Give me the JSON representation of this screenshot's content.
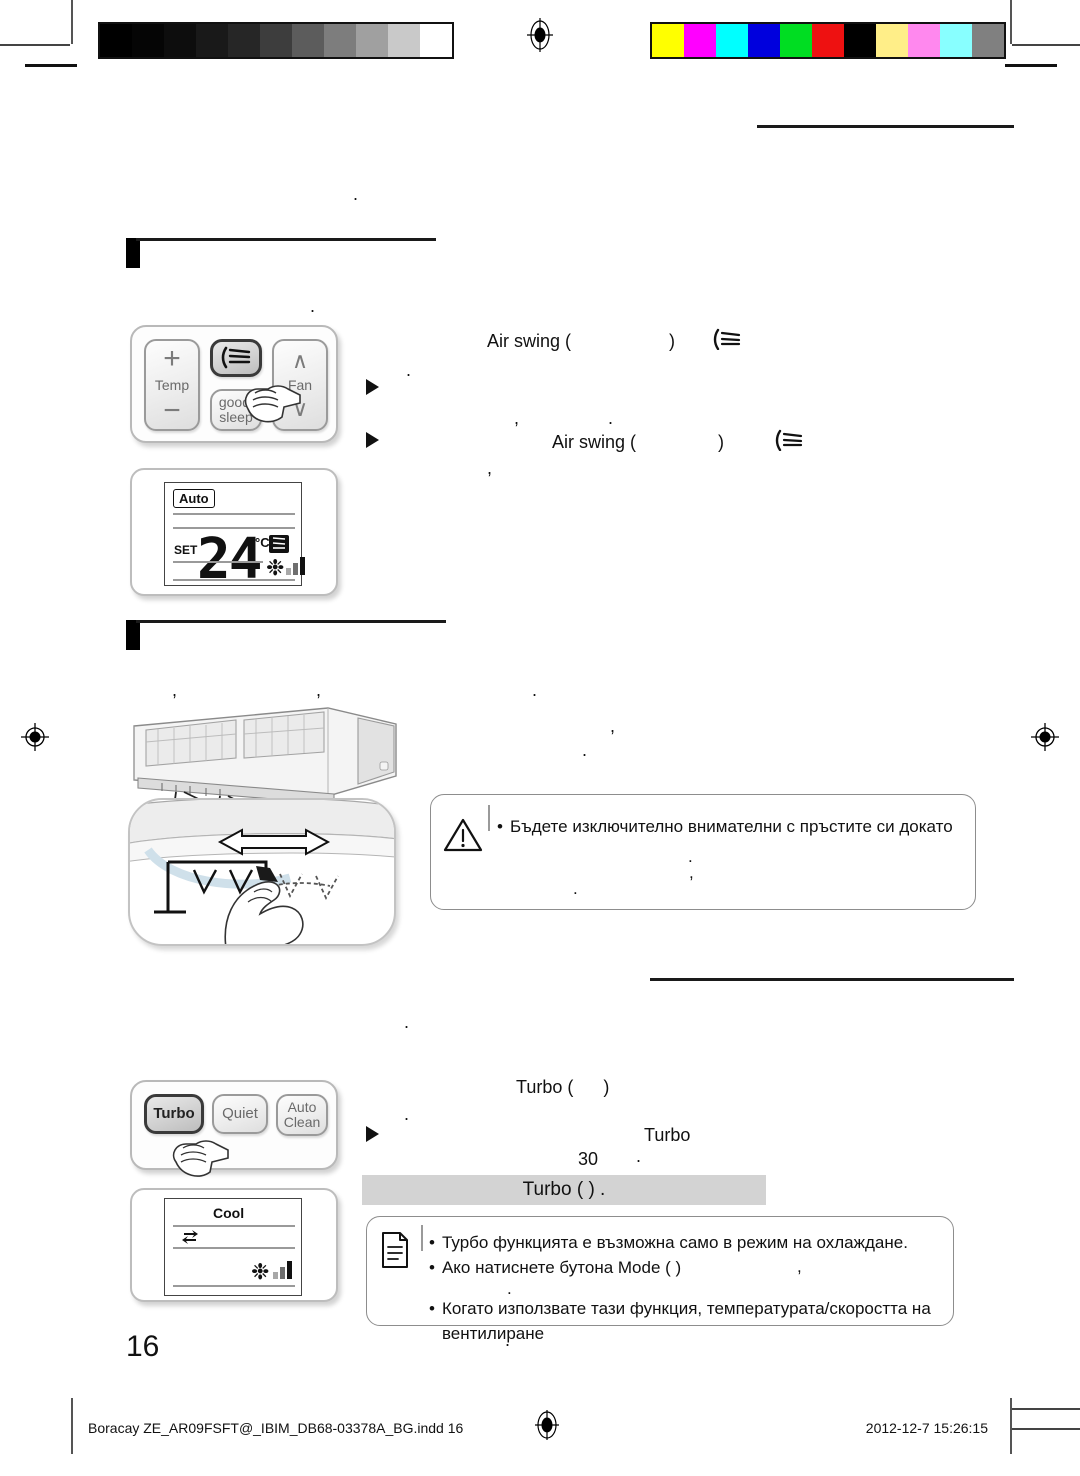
{
  "document": {
    "page_number": "16",
    "footer_left": "Boracay ZE_AR09FSFT@_IBIM_DB68-03378A_BG.indd   16",
    "footer_right": "2012-12-7   15:26:15"
  },
  "calibration": {
    "grayscale_label": "grayscale-step-wedge",
    "gray_steps": [
      "#000000",
      "#050505",
      "#0d0d0d",
      "#191919",
      "#262626",
      "#3d3d3d",
      "#5c5c5c",
      "#7d7d7d",
      "#a0a0a0",
      "#c9c9c9",
      "#ffffff"
    ],
    "color_label": "color-control-patches",
    "color_steps": [
      "#ffff00",
      "#ff00ff",
      "#00ffff",
      "#0000dd",
      "#00dd22",
      "#ee1111",
      "#000000",
      "#ffee88",
      "#ff88ee",
      "#88ffff",
      "#808080"
    ]
  },
  "section_air_swing": {
    "remote": {
      "temp_label": "Temp",
      "plus": "+",
      "minus": "−",
      "fan_label": "Fan",
      "fan_up": "∧",
      "fan_down": "∨",
      "good_sleep_line1": "good’",
      "good_sleep_line2": "sleep",
      "air_swing_icon_name": "air-swing-icon"
    },
    "lcd": {
      "mode": "Auto",
      "set_label": "SET",
      "temperature": "24",
      "unit": "°C",
      "swing_icon_name": "air-swing-indicator-icon",
      "fan_icon_name": "fan-icon",
      "fan_bars": 3
    },
    "lines": {
      "line1": "Air swing (",
      "line1_close": ")",
      "line1_icon": "air-swing-icon",
      "line2_period": ".",
      "bullet1": "▶",
      "bullet1_comma": ",",
      "bullet1_period": ".",
      "bullet2": "▶",
      "bullet2_text": "Air swing (",
      "bullet2_close": ")",
      "bullet2_icon": "air-swing-icon",
      "bullet2_comma": ","
    }
  },
  "section_manual_blades": {
    "illustration_name": "indoor-unit-vertical-blade-adjust",
    "punct": {
      "p1": "›",
      "p2": ",",
      "p3": ",",
      "p4": ".",
      "p5": "›",
      "p6": ",",
      "p7": "."
    },
    "caution": {
      "icon": "warning-triangle-icon",
      "bullets": [
        "Бъдете изключително внимателни с пръстите си докато"
      ],
      "stray_marks": [
        ".",
        ",",
        "."
      ]
    }
  },
  "section_turbo": {
    "remote": {
      "turbo_label": "Turbo",
      "quiet_label": "Quiet",
      "auto_clean_line1": "Auto",
      "auto_clean_line2": "Clean"
    },
    "lcd": {
      "mode": "Cool",
      "turbo_icon_name": "turbo-indicator-icon",
      "fan_icon_name": "fan-icon",
      "fan_bars": 3
    },
    "lines": {
      "line1": "Turbo (",
      "line1_close": ")",
      "line2_period": ".",
      "bullet1": "▶",
      "bullet1_word": "Turbo",
      "bullet1_num": "30",
      "bullet1_period": "."
    },
    "grey_band": "Turbo (      ) .",
    "note": {
      "icon": "note-document-icon",
      "bullets": [
        "Турбо функцията е възможна само в режим на охлаждане.",
        "Ако натиснете бутона Mode (    )",
        "Когато използвате тази функция, температурата/скоростта на вентилиране"
      ],
      "trailing_comma": ",",
      "stray_period": ".",
      "trailing_period": "."
    }
  },
  "colors": {
    "rule": "#1a1a1a",
    "grey_band": "#d3d3d3",
    "callout_border": "#8d8d8d"
  }
}
